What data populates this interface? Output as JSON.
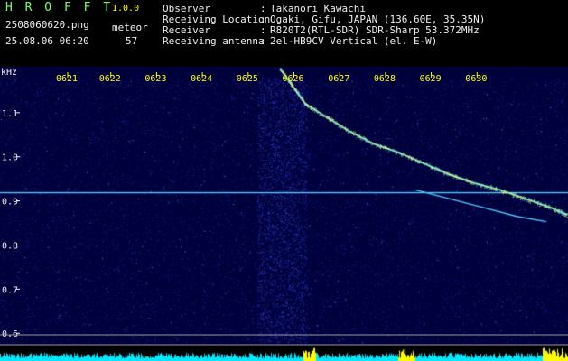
{
  "header": {
    "brand": "H R O F F T",
    "version": "1.0.0",
    "filename": "2508060620.png",
    "meteor_label": "meteor",
    "datetime": "25.08.06 06:20",
    "meteor_count": "57",
    "info": [
      {
        "key": "Observer",
        "value": "Takanori Kawachi"
      },
      {
        "key": "Receiving Location",
        "value": "Ogaki, Gifu, JAPAN (136.60E, 35.35N)"
      },
      {
        "key": "Receiver",
        "value": "R820T2(RTL-SDR) SDR-Sharp 53.372MHz"
      },
      {
        "key": "Receiving antenna",
        "value": "2el-HB9CV Vertical (el. E-W)"
      }
    ],
    "separator": ":"
  },
  "colors": {
    "background": "#000000",
    "spectrogram": "#00003C",
    "echo": "#8CF0A0",
    "carrier": "#50C8FF",
    "power_trace": "#00E8FF",
    "power_peak": "#FFFF00",
    "header_text": "#7CFC6A",
    "time_text": "#FFFF00"
  },
  "chart_data": {
    "type": "heatmap",
    "xlabel": "",
    "ylabel": "kHz",
    "x_ticks": [
      "0621",
      "0622",
      "0623",
      "0624",
      "0625",
      "0626",
      "0627",
      "0628",
      "0629",
      "0630"
    ],
    "y_ticks": [
      "1.1",
      "1.0",
      "0.9",
      "0.8",
      "0.7",
      "0.6"
    ],
    "ylim": [
      0.58,
      1.2
    ],
    "xlim": [
      "0620.6",
      "0630"
    ],
    "carrier_khz": 0.92,
    "echo_trace": [
      {
        "t": 6.2,
        "khz": 1.2
      },
      {
        "t": 6.5,
        "khz": 1.16
      },
      {
        "t": 6.8,
        "khz": 1.12
      },
      {
        "t": 7.3,
        "khz": 1.09
      },
      {
        "t": 7.8,
        "khz": 1.06
      },
      {
        "t": 8.4,
        "khz": 1.03
      },
      {
        "t": 9.0,
        "khz": 1.01
      },
      {
        "t": 9.6,
        "khz": 0.985
      },
      {
        "t": 10.2,
        "khz": 0.96
      },
      {
        "t": 10.8,
        "khz": 0.94
      },
      {
        "t": 11.4,
        "khz": 0.925
      },
      {
        "t": 12.0,
        "khz": 0.905
      },
      {
        "t": 12.6,
        "khz": 0.885
      },
      {
        "t": 13.0,
        "khz": 0.868
      }
    ],
    "secondary_trace": [
      {
        "t": 9.4,
        "khz": 0.925
      },
      {
        "t": 10.2,
        "khz": 0.905
      },
      {
        "t": 11.0,
        "khz": 0.885
      },
      {
        "t": 11.8,
        "khz": 0.865
      },
      {
        "t": 12.5,
        "khz": 0.853
      }
    ]
  }
}
